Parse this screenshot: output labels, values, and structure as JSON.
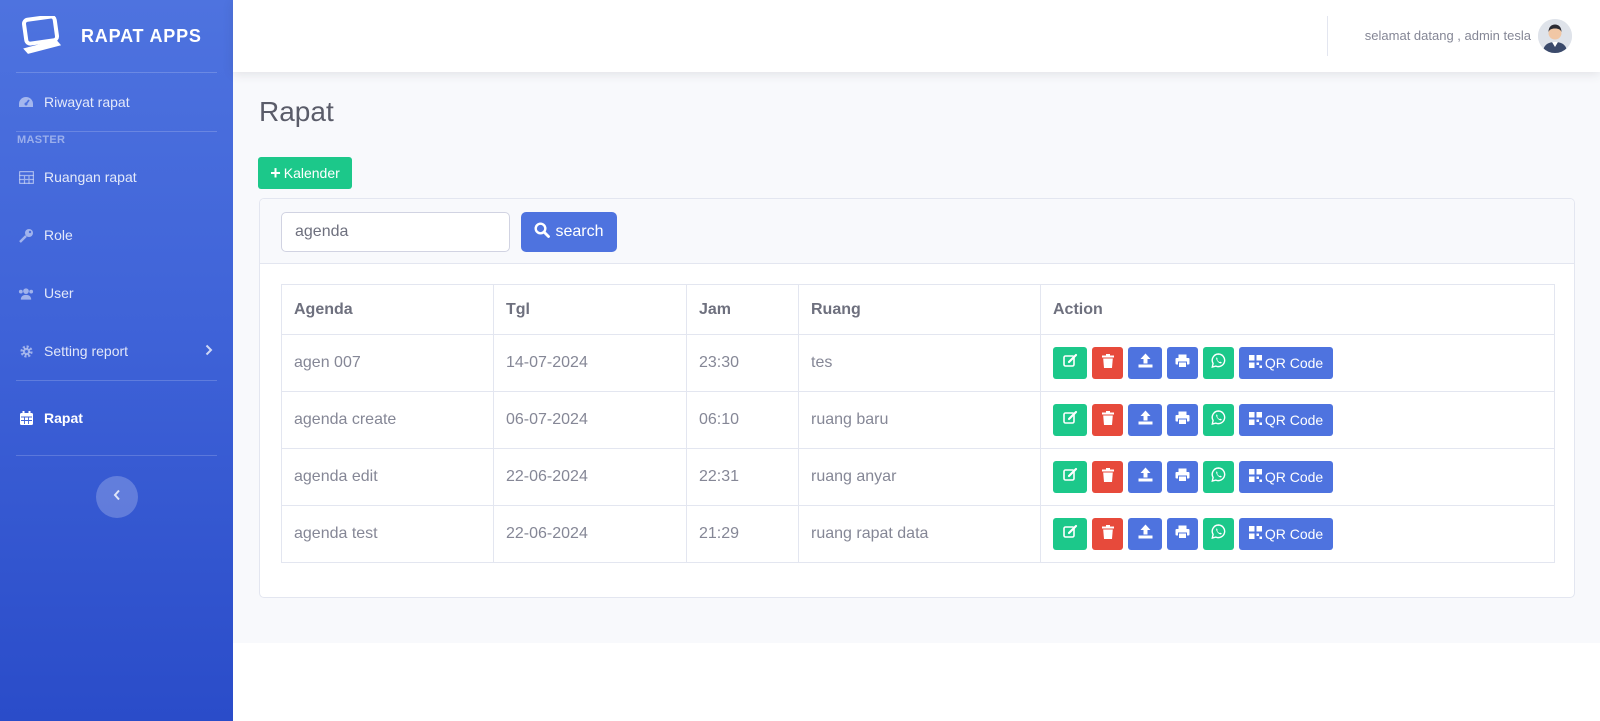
{
  "app": {
    "brand": "RAPAT APPS"
  },
  "sidebar": {
    "items": [
      {
        "label": "Riwayat rapat",
        "icon": "tachometer-icon"
      },
      {
        "heading": "MASTER"
      },
      {
        "label": "Ruangan rapat",
        "icon": "table-icon"
      },
      {
        "label": "Role",
        "icon": "key-icon"
      },
      {
        "label": "User",
        "icon": "users-icon"
      },
      {
        "label": "Setting report",
        "icon": "cog-icon"
      },
      {
        "label": "Rapat",
        "icon": "calendar-icon",
        "active": true
      }
    ]
  },
  "topbar": {
    "welcome": "selamat datang , admin tesla"
  },
  "page": {
    "title": "Rapat",
    "kalender_button": "Kalender"
  },
  "search": {
    "value": "agenda",
    "button": "search"
  },
  "table": {
    "headers": [
      "Agenda",
      "Tgl",
      "Jam",
      "Ruang",
      "Action"
    ],
    "rows": [
      [
        "agen 007",
        "14-07-2024",
        "23:30",
        "tes"
      ],
      [
        "agenda create",
        "06-07-2024",
        "06:10",
        "ruang baru"
      ],
      [
        "agenda edit",
        "22-06-2024",
        "22:31",
        "ruang anyar"
      ],
      [
        "agenda test",
        "22-06-2024",
        "21:29",
        "ruang rapat data"
      ]
    ],
    "qr_label": "QR Code"
  },
  "colors": {
    "primary": "#4e73df",
    "success": "#1cc88a",
    "danger": "#e74a3b"
  }
}
